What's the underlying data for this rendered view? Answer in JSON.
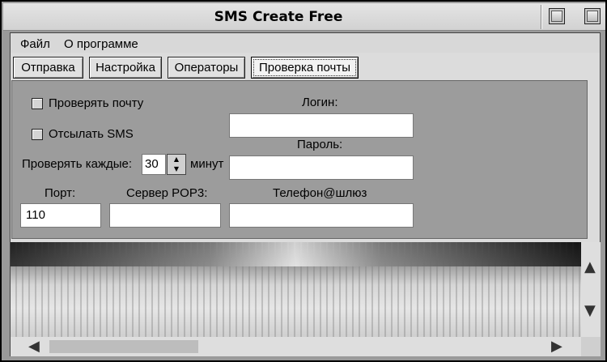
{
  "window": {
    "title": "SMS Create Free"
  },
  "menu": {
    "items": [
      "Файл",
      "О программе"
    ]
  },
  "tabs": [
    "Отправка",
    "Настройка",
    "Операторы",
    "Проверка почты"
  ],
  "panel": {
    "check_mail_label": "Проверять почту",
    "send_sms_label": "Отсылать SMS",
    "check_every_label": "Проверять каждые:",
    "interval_value": "30",
    "minutes_label": "минут",
    "login_label": "Логин:",
    "login_value": "",
    "password_label": "Пароль:",
    "password_value": "",
    "port_label": "Порт:",
    "port_value": "110",
    "pop3_label": "Сервер POP3:",
    "pop3_value": "",
    "phone_gateway_label": "Телефон@шлюз",
    "phone_gateway_value": ""
  },
  "icons": {
    "scroll_up": "▲",
    "scroll_down": "▼",
    "scroll_left": "◀",
    "scroll_right": "▶"
  }
}
